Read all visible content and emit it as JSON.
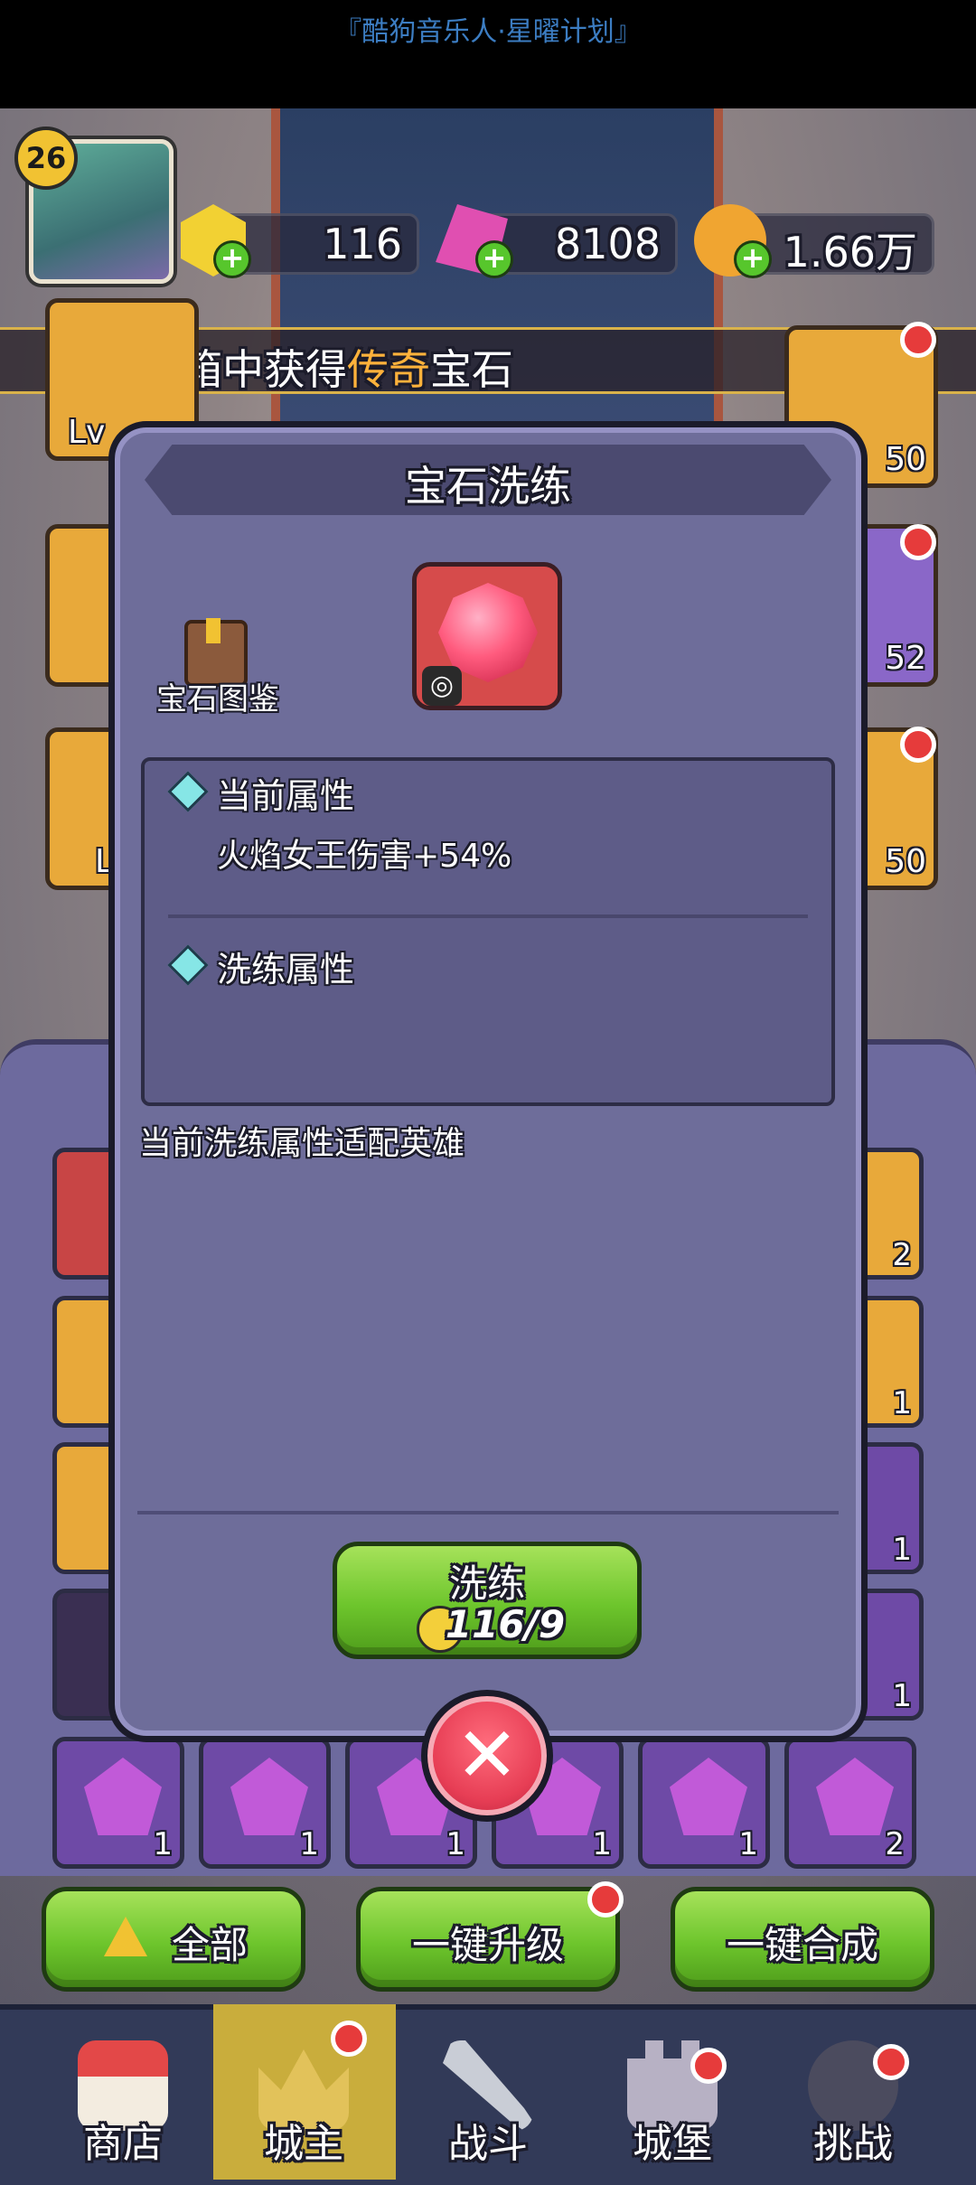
{
  "status_bar": {
    "caption": "『酷狗音乐人·星曜计划』"
  },
  "player": {
    "level": "26"
  },
  "resources": [
    {
      "name": "yellow-gem",
      "value": "116",
      "color": "#f2d133"
    },
    {
      "name": "pink-gem",
      "value": "8108",
      "color": "#e04fb1"
    },
    {
      "name": "gold-coin",
      "value": "1.66万",
      "color": "#f0a531"
    }
  ],
  "banner": {
    "prefix": "璀璨宝箱中获得",
    "highlight": "传奇",
    "suffix": "宝石"
  },
  "side_tiles": {
    "left": [
      {
        "label": "Lv"
      },
      {
        "label": ""
      },
      {
        "label": "L"
      }
    ],
    "right": [
      {
        "num": "50"
      },
      {
        "num": "52"
      },
      {
        "num": "50"
      }
    ]
  },
  "modal": {
    "title": "宝石洗练",
    "codex_label": "宝石图鉴",
    "ring_icon": "ring-icon",
    "current_attr_header": "当前属性",
    "current_attr_value": "火焰女王伤害+54%",
    "refine_attr_header": "洗练属性",
    "refine_attr_value": "",
    "hint": "当前洗练属性适配英雄",
    "refine_button": {
      "label": "洗练",
      "cost": "116/9"
    },
    "close_icon": "close-icon"
  },
  "inventory": {
    "left_col_counts": [
      "",
      "",
      "",
      ""
    ],
    "right_col_counts": [
      "2",
      "1",
      "1",
      "1"
    ],
    "bottom_row_counts": [
      "1",
      "1",
      "1",
      "1",
      "1",
      "2"
    ]
  },
  "actions": {
    "all": "全部",
    "upgrade_all": "一键升级",
    "merge_all": "一键合成"
  },
  "nav": [
    {
      "label": "商店",
      "icon": "shop-icon"
    },
    {
      "label": "城主",
      "icon": "crown-icon",
      "active": true
    },
    {
      "label": "战斗",
      "icon": "swords-icon"
    },
    {
      "label": "城堡",
      "icon": "castle-icon"
    },
    {
      "label": "挑战",
      "icon": "demon-icon"
    }
  ],
  "colors": {
    "modal_bg": "#6e6d9a",
    "button_green": "#6dc52c",
    "close_red": "#e73e55",
    "banner_highlight": "#ffb23b",
    "nav_active": "#c9ad3c"
  }
}
